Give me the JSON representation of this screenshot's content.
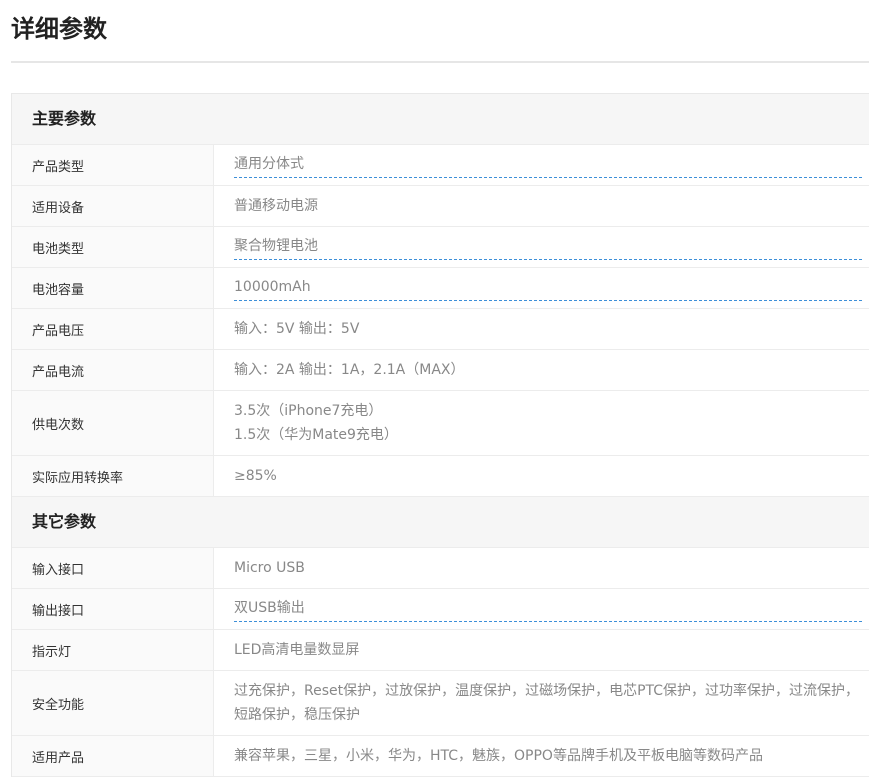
{
  "page": {
    "title": "详细参数"
  },
  "sections": [
    {
      "title": "主要参数",
      "rows": [
        {
          "label": "产品类型",
          "value": "通用分体式",
          "linked": true
        },
        {
          "label": "适用设备",
          "value": "普通移动电源",
          "linked": false
        },
        {
          "label": "电池类型",
          "value": "聚合物锂电池",
          "linked": true
        },
        {
          "label": "电池容量",
          "value": "10000mAh",
          "linked": true
        },
        {
          "label": "产品电压",
          "value": "输入：5V 输出：5V",
          "linked": false
        },
        {
          "label": "产品电流",
          "value": "输入：2A 输出：1A，2.1A（MAX）",
          "linked": false
        },
        {
          "label": "供电次数",
          "value_lines": [
            "3.5次（iPhone7充电）",
            "1.5次（华为Mate9充电）"
          ],
          "linked": false
        },
        {
          "label": "实际应用转换率",
          "value": "≥85%",
          "linked": false
        }
      ]
    },
    {
      "title": "其它参数",
      "rows": [
        {
          "label": "输入接口",
          "value": "Micro USB",
          "linked": false
        },
        {
          "label": "输出接口",
          "value": "双USB输出",
          "linked": true
        },
        {
          "label": "指示灯",
          "value": "LED高清电量数显屏",
          "linked": false
        },
        {
          "label": "安全功能",
          "value_lines": [
            "过充保护，Reset保护，过放保护，温度保护，过磁场保护，电芯PTC保护，过功率保护，过流保护，",
            "短路保护，稳压保护"
          ],
          "linked": false
        },
        {
          "label": "适用产品",
          "value": "兼容苹果，三星，小米，华为，HTC，魅族，OPPO等品牌手机及平板电脑等数码产品",
          "linked": false
        }
      ]
    }
  ]
}
